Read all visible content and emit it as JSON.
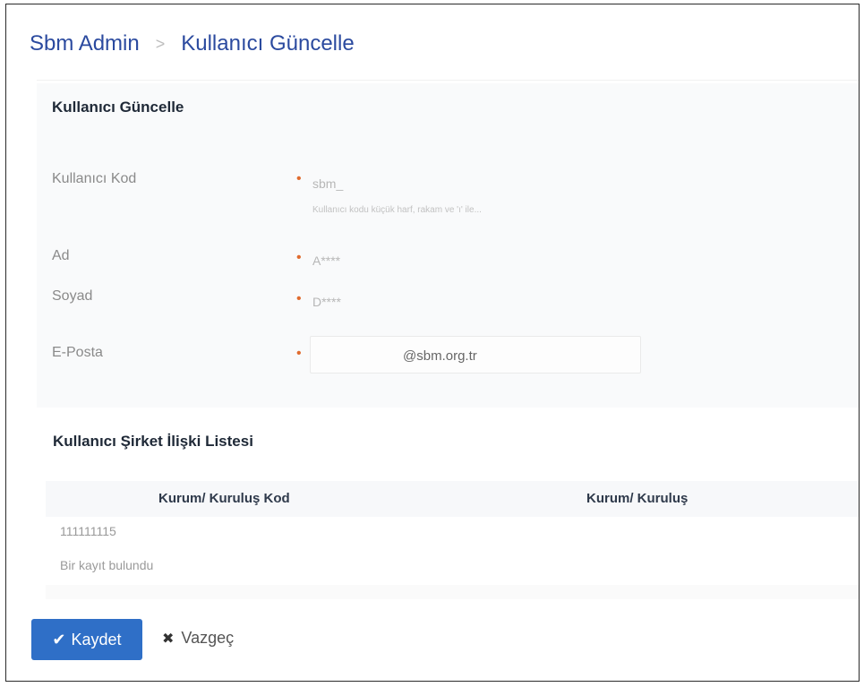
{
  "breadcrumb": {
    "root": "Sbm Admin",
    "separator": ">",
    "current": "Kullanıcı Güncelle"
  },
  "form": {
    "title": "Kullanıcı Güncelle",
    "fields": {
      "kod": {
        "label": "Kullanıcı Kod",
        "value": "sbm_",
        "hint": "Kullanıcı kodu küçük harf, rakam ve 'ı' ile..."
      },
      "ad": {
        "label": "Ad",
        "value": "A****"
      },
      "soyad": {
        "label": "Soyad",
        "value": "D****"
      },
      "eposta": {
        "label": "E-Posta",
        "value": "@sbm.org.tr"
      }
    },
    "required_mark": "•"
  },
  "relations": {
    "title": "Kullanıcı Şirket İlişki Listesi",
    "columns": [
      "Kurum/ Kuruluş Kod",
      "Kurum/ Kuruluş"
    ],
    "rows": [
      [
        "111111115",
        ""
      ]
    ],
    "count_text": "Bir kayıt bulundu"
  },
  "actions": {
    "save_label": "Kaydet",
    "cancel_label": "Vazgeç",
    "save_icon": "check-icon",
    "cancel_icon": "times-icon",
    "accent": "#2f6fc7"
  }
}
